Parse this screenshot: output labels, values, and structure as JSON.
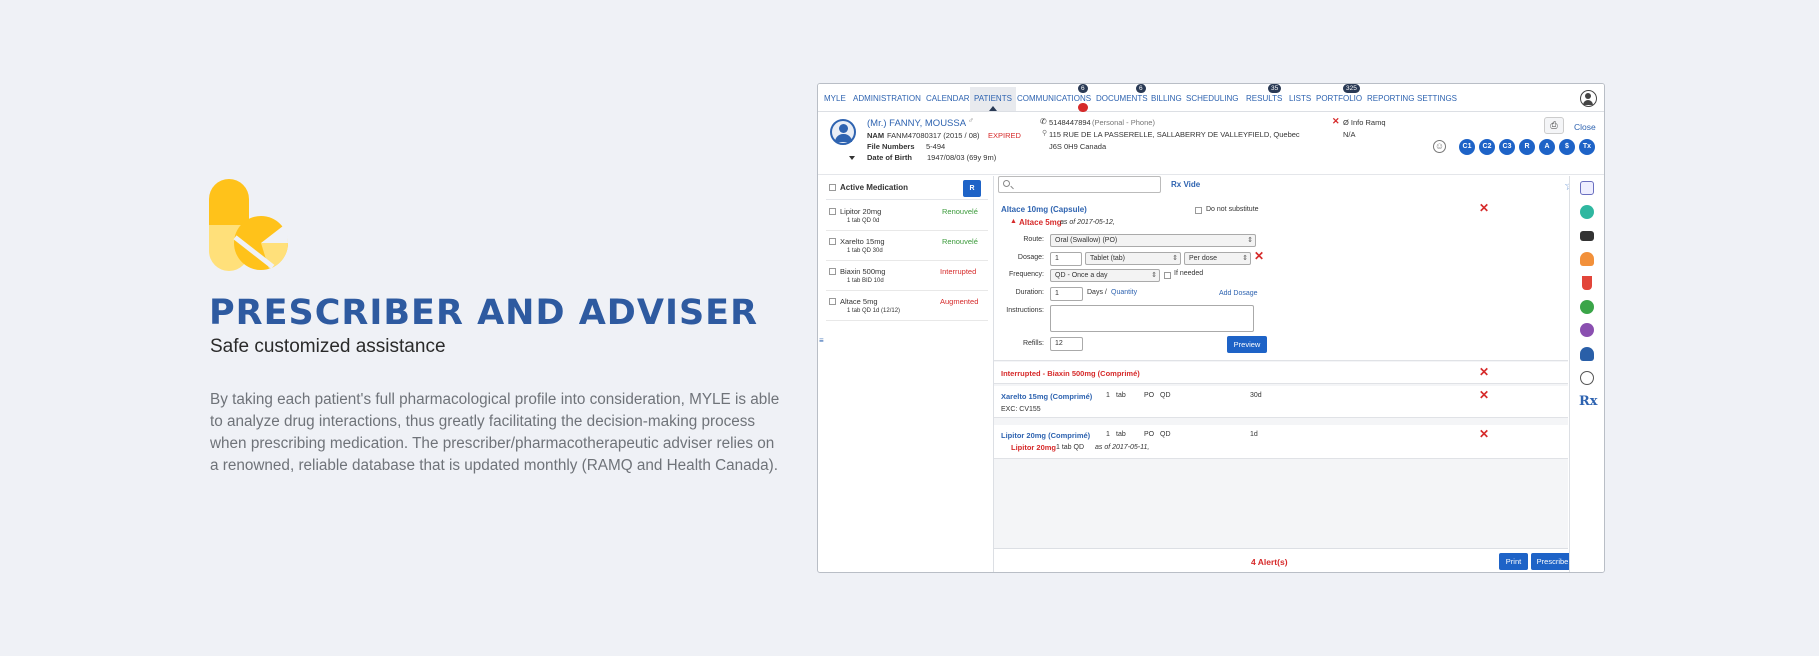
{
  "hero": {
    "title": "PRESCRIBER AND ADVISER",
    "subtitle": "Safe customized assistance",
    "description": "By taking each patient's full pharmacological profile into consideration, MYLE is able to analyze drug interactions, thus greatly facilitating the decision-making process when prescribing medication. The prescriber/pharmacotherapeutic adviser relies on a renowned, reliable database that is updated monthly (RAMQ and Health Canada).",
    "logo_colors": {
      "primary": "#ffc21a",
      "light": "#ffe07a"
    }
  },
  "colors": {
    "accent": "#1e63c7",
    "title_blue": "#2e5aa0",
    "alert_red": "#d62a2a",
    "renew_green": "#3a9a3a"
  },
  "nav": {
    "items": [
      {
        "label": "MYLE"
      },
      {
        "label": "ADMINISTRATION"
      },
      {
        "label": "CALENDAR"
      },
      {
        "label": "PATIENTS",
        "active": true
      },
      {
        "label": "COMMUNICATIONS",
        "badge": "6",
        "badge2": "2"
      },
      {
        "label": "DOCUMENTS",
        "badge": "6"
      },
      {
        "label": "BILLING"
      },
      {
        "label": "SCHEDULING"
      },
      {
        "label": "RESULTS",
        "badge": "35"
      },
      {
        "label": "LISTS"
      },
      {
        "label": "PORTFOLIO",
        "badge": "325"
      },
      {
        "label": "REPORTING"
      },
      {
        "label": "SETTINGS"
      }
    ],
    "user_icon": "user-circle-icon"
  },
  "patient": {
    "name": "(Mr.) FANNY, MOUSSA",
    "gender_symbol": "♂",
    "nam_label": "NAM",
    "nam_value": "FANM47080317 (2015 / 08)",
    "nam_status": "EXPIRED",
    "file_label": "File Numbers",
    "file_value": "5-494",
    "dob_label": "Date of Birth",
    "dob_value": "1947/08/03 (69y 9m)",
    "phone": "5148447894",
    "phone_type": "(Personal - Phone)",
    "address_line1": "115 RUE DE LA PASSERELLE, SALLABERRY DE VALLEYFIELD, Quebec",
    "address_line2": "J6S 0H9 Canada",
    "ramq_label": "Ø Info Ramq",
    "ramq_value": "N/A",
    "close_label": "Close",
    "circles": [
      "C1",
      "C2",
      "C3",
      "R",
      "A",
      "$",
      "Tx"
    ]
  },
  "active_medication": {
    "header": "Active Medication",
    "r_button": "R",
    "items": [
      {
        "name": "Lipitor 20mg",
        "dose": "1 tab QD 0d",
        "status": "Renouvelé",
        "status_color": "green"
      },
      {
        "name": "Xarelto 15mg",
        "dose": "1 tab QD 30d",
        "status": "Renouvelé",
        "status_color": "green"
      },
      {
        "name": "Biaxin 500mg",
        "dose": "1 tab BID 10d",
        "status": "Interrupted",
        "status_color": "red"
      },
      {
        "name": "Altace 5mg",
        "dose": "1 tab QD 1d (12/12)",
        "status": "Augmented",
        "status_color": "red"
      }
    ]
  },
  "prescription": {
    "search_placeholder": "",
    "rx_vide": "Rx Vide",
    "drug_title": "Altace 10mg (Capsule)",
    "do_not_substitute": "Do not substitute",
    "previous_drug": "Altace 5mg",
    "previous_asof": "as of 2017-05-12,",
    "route_label": "Route:",
    "route_value": "Oral (Swallow) (PO)",
    "dosage_label": "Dosage:",
    "dosage_qty": "1",
    "dosage_form": "Tablet (tab)",
    "dosage_per": "Per dose",
    "frequency_label": "Frequency:",
    "frequency_value": "QD - Once a day",
    "if_needed": "If needed",
    "duration_label": "Duration:",
    "duration_value": "1",
    "duration_unit": "Days /",
    "quantity_link": "Quantity",
    "add_dosage": "Add Dosage",
    "instructions_label": "Instructions:",
    "refills_label": "Refills:",
    "refills_value": "12",
    "preview_button": "Preview"
  },
  "other_rx": [
    {
      "title": "Interrupted - Biaxin 500mg (Comprimé)"
    },
    {
      "title": "Xarelto 15mg (Comprimé)",
      "qty": "1",
      "unit": "tab",
      "route": "PO",
      "freq": "QD",
      "dur": "30d",
      "note": "EXC: CV155"
    },
    {
      "title": "Lipitor 20mg (Comprimé)",
      "qty": "1",
      "unit": "tab",
      "route": "PO",
      "freq": "QD",
      "dur": "1d",
      "sub_drug": "Lipitor 20mg",
      "sub_dose": "1 tab QD",
      "sub_asof": "as of 2017-05-11,"
    }
  ],
  "footer": {
    "alerts": "4 Alert(s)",
    "print": "Print",
    "prescribe": "Prescribe"
  },
  "side_tab": "≡",
  "right_icons": [
    "form-icon",
    "clock-icon",
    "folder-icon",
    "person-icon",
    "flask-icon",
    "pie-chart-icon",
    "family-icon",
    "doctor-icon",
    "stethoscope-icon",
    "rx-icon"
  ],
  "rx_icon_text": "Rx"
}
